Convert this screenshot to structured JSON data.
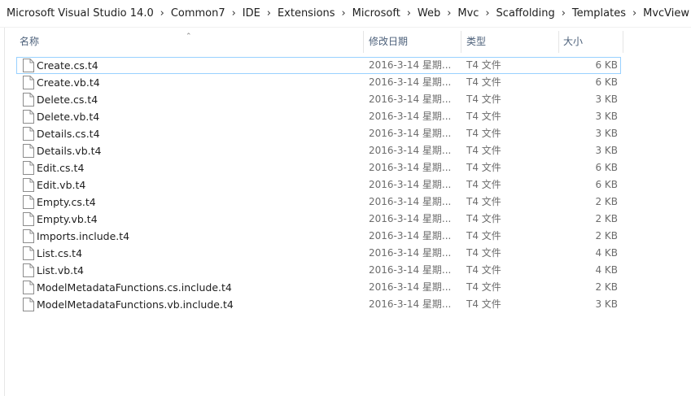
{
  "breadcrumb": [
    "Microsoft Visual Studio 14.0",
    "Common7",
    "IDE",
    "Extensions",
    "Microsoft",
    "Web",
    "Mvc",
    "Scaffolding",
    "Templates",
    "MvcView"
  ],
  "columns": {
    "name": "名称",
    "date": "修改日期",
    "type": "类型",
    "size": "大小"
  },
  "sort": {
    "column": "name",
    "direction": "ascending",
    "icon": "chevron-up-icon"
  },
  "files": [
    {
      "name": "Create.cs.t4",
      "date": "2016-3-14 星期...",
      "type": "T4 文件",
      "size": "6 KB",
      "focused": true
    },
    {
      "name": "Create.vb.t4",
      "date": "2016-3-14 星期...",
      "type": "T4 文件",
      "size": "6 KB"
    },
    {
      "name": "Delete.cs.t4",
      "date": "2016-3-14 星期...",
      "type": "T4 文件",
      "size": "3 KB"
    },
    {
      "name": "Delete.vb.t4",
      "date": "2016-3-14 星期...",
      "type": "T4 文件",
      "size": "3 KB"
    },
    {
      "name": "Details.cs.t4",
      "date": "2016-3-14 星期...",
      "type": "T4 文件",
      "size": "3 KB"
    },
    {
      "name": "Details.vb.t4",
      "date": "2016-3-14 星期...",
      "type": "T4 文件",
      "size": "3 KB"
    },
    {
      "name": "Edit.cs.t4",
      "date": "2016-3-14 星期...",
      "type": "T4 文件",
      "size": "6 KB"
    },
    {
      "name": "Edit.vb.t4",
      "date": "2016-3-14 星期...",
      "type": "T4 文件",
      "size": "6 KB"
    },
    {
      "name": "Empty.cs.t4",
      "date": "2016-3-14 星期...",
      "type": "T4 文件",
      "size": "2 KB"
    },
    {
      "name": "Empty.vb.t4",
      "date": "2016-3-14 星期...",
      "type": "T4 文件",
      "size": "2 KB"
    },
    {
      "name": "Imports.include.t4",
      "date": "2016-3-14 星期...",
      "type": "T4 文件",
      "size": "2 KB"
    },
    {
      "name": "List.cs.t4",
      "date": "2016-3-14 星期...",
      "type": "T4 文件",
      "size": "4 KB"
    },
    {
      "name": "List.vb.t4",
      "date": "2016-3-14 星期...",
      "type": "T4 文件",
      "size": "4 KB"
    },
    {
      "name": "ModelMetadataFunctions.cs.include.t4",
      "date": "2016-3-14 星期...",
      "type": "T4 文件",
      "size": "2 KB"
    },
    {
      "name": "ModelMetadataFunctions.vb.include.t4",
      "date": "2016-3-14 星期...",
      "type": "T4 文件",
      "size": "3 KB"
    }
  ],
  "file_icon": "document-icon"
}
